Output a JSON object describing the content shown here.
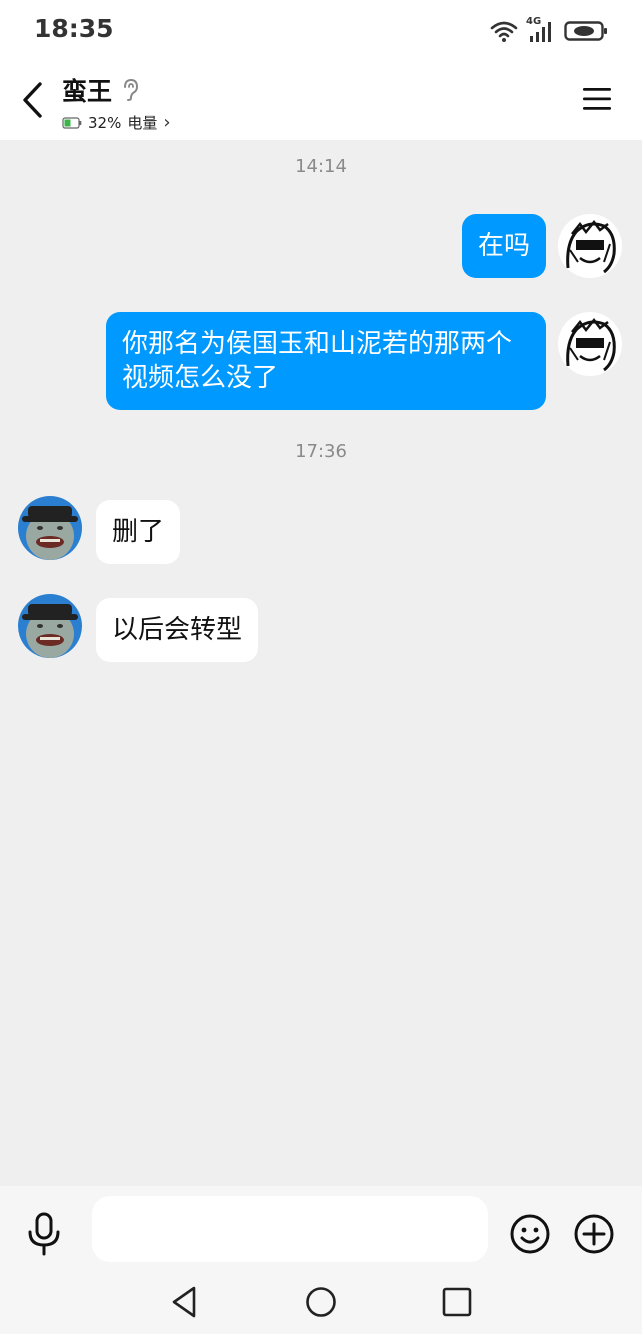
{
  "status_bar": {
    "time": "18:35",
    "network": "4G"
  },
  "header": {
    "title": "蛮王",
    "battery_level": "32%",
    "battery_suffix": "电量",
    "chevron": "›"
  },
  "messages": [
    {
      "kind": "time",
      "text": "14:14"
    },
    {
      "kind": "outgoing",
      "text": "在吗"
    },
    {
      "kind": "outgoing",
      "text": "你那名为侯国玉和山泥若的那两个视频怎么没了"
    },
    {
      "kind": "time",
      "text": "17:36"
    },
    {
      "kind": "incoming",
      "text": "删了"
    },
    {
      "kind": "incoming",
      "text": "以后会转型"
    }
  ],
  "input": {
    "value": "",
    "placeholder": ""
  },
  "colors": {
    "outgoing_bubble": "#0099ff",
    "incoming_bubble": "#ffffff",
    "background": "#efefef"
  },
  "icons": {
    "back": "chevron-left-icon",
    "ear": "ear-icon",
    "menu": "hamburger-menu-icon",
    "mic": "microphone-icon",
    "emoji": "smiley-icon",
    "plus": "plus-circle-icon",
    "nav_back": "triangle-back-icon",
    "nav_home": "circle-home-icon",
    "nav_recent": "square-recent-icon"
  }
}
